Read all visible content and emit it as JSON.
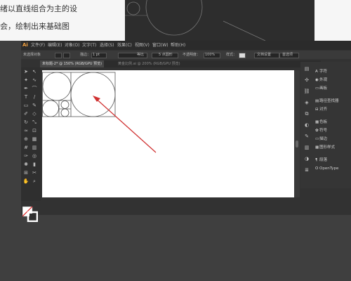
{
  "caption": {
    "line1": "绪以直线组合为主的设",
    "line2": "会，绘制出来基础图"
  },
  "app": {
    "logo": "Ai",
    "menu": [
      "文件(F)",
      "编辑(E)",
      "对象(O)",
      "文字(T)",
      "选择(S)",
      "效果(C)",
      "视图(V)",
      "窗口(W)",
      "帮助(H)"
    ]
  },
  "control_bar": {
    "selection": "未选择对象",
    "stroke_label": "描边：",
    "stroke_value": "1 pt",
    "stroke_style": "等比",
    "brush": "5 点圆形",
    "opacity_label": "不透明度：",
    "opacity_value": "100%",
    "style_label": "样式：",
    "doc_setup": "文档设置",
    "prefs": "首选项"
  },
  "tabs": [
    {
      "label": "未标题-2* @ 150% (RGB/GPU 预览)",
      "active": true
    },
    {
      "label": "黄金比例.ai @ 200% (RGB/GPU 预览)",
      "active": false
    }
  ],
  "panel": {
    "items": [
      {
        "icon": "A",
        "label": "字符"
      },
      {
        "icon": "◉",
        "label": "外观"
      },
      {
        "icon": "▭",
        "label": "画板"
      },
      {
        "icon": "▤",
        "label": "路径查找器"
      },
      {
        "icon": "⊟",
        "label": "对齐"
      },
      {
        "icon": "▦",
        "label": "色板"
      },
      {
        "icon": "✿",
        "label": "符号"
      },
      {
        "icon": "▭",
        "label": "描边"
      },
      {
        "icon": "▦",
        "label": "图形样式"
      },
      {
        "icon": "¶",
        "label": "段落"
      },
      {
        "icon": "O",
        "label": "OpenType"
      }
    ]
  },
  "colors": {
    "arrow": "#d03030",
    "canvas": "#ffffff",
    "workspace": "#3f3f3f",
    "ai_logo": "#f0a040"
  }
}
